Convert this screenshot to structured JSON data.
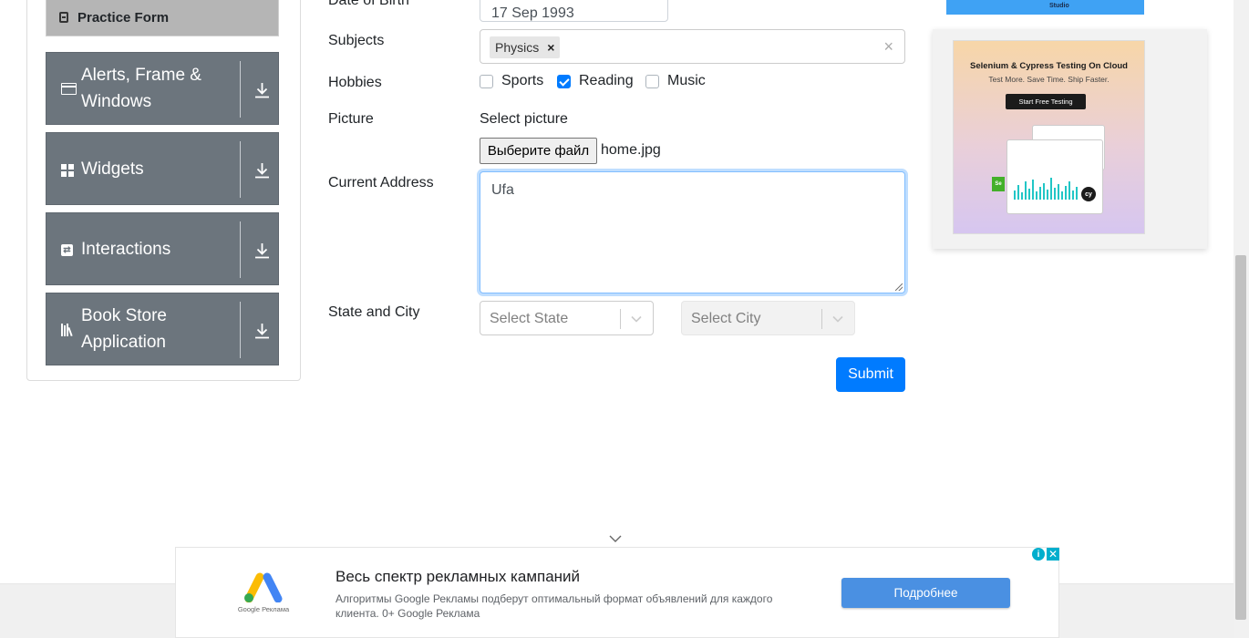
{
  "sidebar": {
    "active_item": "Practice Form",
    "groups": [
      {
        "label": "Alerts, Frame & Windows",
        "icon": "window-icon"
      },
      {
        "label": "Widgets",
        "icon": "widgets-icon"
      },
      {
        "label": "Interactions",
        "icon": "interactions-icon"
      },
      {
        "label": "Book Store Application",
        "icon": "book-icon"
      }
    ],
    "group_color": "#6c757d",
    "active_color": "#b5b5b5"
  },
  "form": {
    "dob_label": "Date of Birth",
    "dob_value": "17 Sep 1993",
    "subjects_label": "Subjects",
    "subjects": [
      "Physics"
    ],
    "hobbies_label": "Hobbies",
    "hobbies": [
      {
        "label": "Sports",
        "checked": false
      },
      {
        "label": "Reading",
        "checked": true
      },
      {
        "label": "Music",
        "checked": false
      }
    ],
    "picture_label": "Picture",
    "picture_hint": "Select picture",
    "file_button": "Выберите файл",
    "file_name": "home.jpg",
    "address_label": "Current Address",
    "address_value": "Ufa",
    "state_city_label": "State and City",
    "state_placeholder": "Select State",
    "city_placeholder": "Select City",
    "submit_label": "Submit",
    "accent_color": "#007bff"
  },
  "right_ad": {
    "top_strip_text": "Studio",
    "title": "Selenium & Cypress Testing On Cloud",
    "subtitle": "Test More. Save Time. Ship Faster.",
    "button": "Start Free Testing",
    "badge_se": "Se",
    "badge_cy": "cy"
  },
  "bottom_ad": {
    "logo_text": "Google Реклама",
    "headline": "Весь спектр рекламных кампаний",
    "description": "Алгоритмы Google Рекламы подберут оптимальный формат объявлений для каждого клиента. 0+ Google Реклама",
    "cta": "Подробнее",
    "info_icon": "i",
    "close_icon": "✕"
  }
}
